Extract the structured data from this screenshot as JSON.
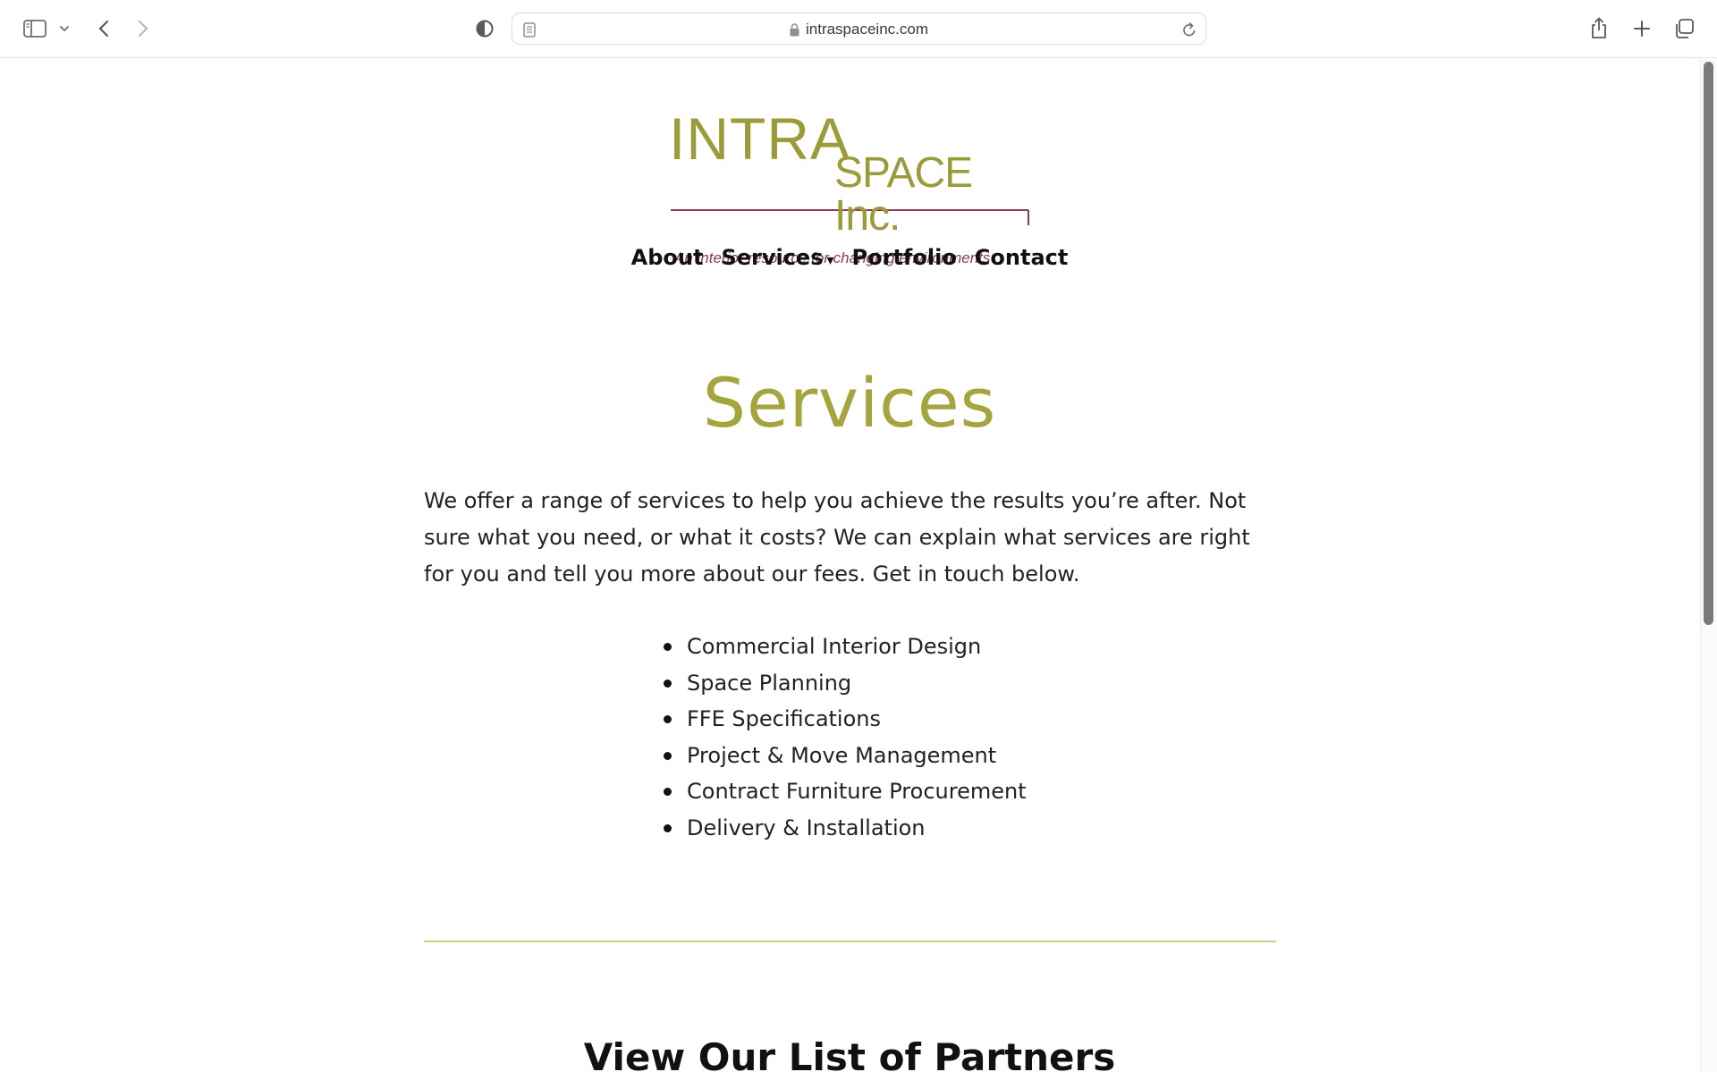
{
  "browser": {
    "url": "intraspaceinc.com"
  },
  "logo": {
    "line1": "INTRA",
    "line2": "SPACE Inc.",
    "tagline": "An interior resource for changing environments"
  },
  "nav": {
    "about": "About",
    "services": "Services",
    "services_caret": "▾",
    "portfolio": "Portfolio",
    "contact": "Contact"
  },
  "main": {
    "title": "Services",
    "intro": "We offer a range of services to help you achieve the results you’re after. Not sure what you need, or what it costs? We can explain what services are right for you and tell you more about our fees. Get in touch below.",
    "services_list": [
      "Commercial Interior Design",
      "Space Planning",
      "FFE Specifications",
      "Project & Move Management",
      "Contract Furniture Procurement",
      "Delivery & Installation"
    ],
    "partners_heading": "View Our List of Partners"
  },
  "colors": {
    "brand_olive": "#a5a43e",
    "brand_plum": "#8a3a5c",
    "divider": "#c9d27c"
  }
}
